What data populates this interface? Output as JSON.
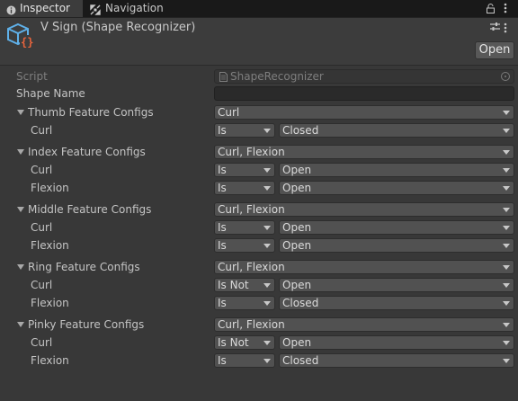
{
  "tabs": [
    {
      "label": "Inspector",
      "icon": "info-icon",
      "active": true
    },
    {
      "label": "Navigation",
      "icon": "navigation-icon",
      "active": false
    }
  ],
  "header": {
    "title": "V Sign (Shape Recognizer)",
    "icon": "scriptable-object-icon",
    "open_label": "Open"
  },
  "script": {
    "label": "Script",
    "value": "ShapeRecognizer"
  },
  "shape_name": {
    "label": "Shape Name",
    "value": ""
  },
  "configs": [
    {
      "label": "Thumb Feature Configs",
      "value": "Curl",
      "features": [
        {
          "label": "Curl",
          "mode": "Is",
          "state": "Closed"
        }
      ]
    },
    {
      "label": "Index Feature Configs",
      "value": "Curl, Flexion",
      "features": [
        {
          "label": "Curl",
          "mode": "Is",
          "state": "Open"
        },
        {
          "label": "Flexion",
          "mode": "Is",
          "state": "Open"
        }
      ]
    },
    {
      "label": "Middle Feature Configs",
      "value": "Curl, Flexion",
      "features": [
        {
          "label": "Curl",
          "mode": "Is",
          "state": "Open"
        },
        {
          "label": "Flexion",
          "mode": "Is",
          "state": "Open"
        }
      ]
    },
    {
      "label": "Ring Feature Configs",
      "value": "Curl, Flexion",
      "features": [
        {
          "label": "Curl",
          "mode": "Is Not",
          "state": "Open"
        },
        {
          "label": "Flexion",
          "mode": "Is",
          "state": "Closed"
        }
      ]
    },
    {
      "label": "Pinky Feature Configs",
      "value": "Curl, Flexion",
      "features": [
        {
          "label": "Curl",
          "mode": "Is Not",
          "state": "Open"
        },
        {
          "label": "Flexion",
          "mode": "Is",
          "state": "Closed"
        }
      ]
    }
  ]
}
